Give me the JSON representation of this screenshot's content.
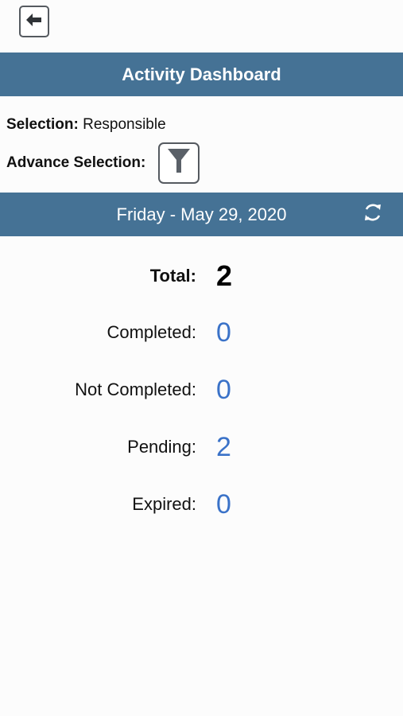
{
  "header": {
    "back_icon": "arrow-left-icon",
    "title": "Activity Dashboard"
  },
  "selection": {
    "label": "Selection:",
    "value": "Responsible"
  },
  "advance_selection": {
    "label": "Advance Selection:",
    "icon": "filter-icon"
  },
  "date_bar": {
    "date": "Friday - May 29, 2020",
    "refresh_icon": "refresh-icon"
  },
  "stats": {
    "total": {
      "label": "Total:",
      "value": "2"
    },
    "completed": {
      "label": "Completed:",
      "value": "0"
    },
    "not_completed": {
      "label": "Not Completed:",
      "value": "0"
    },
    "pending": {
      "label": "Pending:",
      "value": "2"
    },
    "expired": {
      "label": "Expired:",
      "value": "0"
    }
  },
  "colors": {
    "header_bg": "#457295",
    "value_blue": "#3a72c8"
  }
}
